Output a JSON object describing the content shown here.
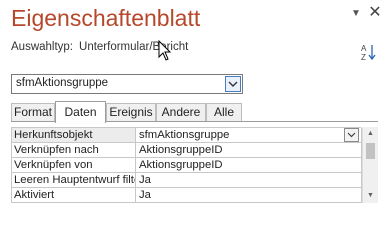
{
  "pane": {
    "title": "Eigenschaftenblatt",
    "dropdown_glyph": "▼",
    "close_glyph": "✕",
    "selection_type_label": "Auswahltyp:",
    "selection_type_value": "Unterformular/Bericht",
    "sort_icon": "sort-az-icon"
  },
  "object_combo": {
    "value": "sfmAktionsgruppe"
  },
  "tabs": [
    {
      "label": "Format"
    },
    {
      "label": "Daten"
    },
    {
      "label": "Ereignis"
    },
    {
      "label": "Andere"
    },
    {
      "label": "Alle"
    }
  ],
  "properties": [
    {
      "key": "Herkunftsobjekt",
      "value": "sfmAktionsgruppe"
    },
    {
      "key": "Verknüpfen nach",
      "value": "AktionsgruppeID"
    },
    {
      "key": "Verknüpfen von",
      "value": "AktionsgruppeID"
    },
    {
      "key": "Leeren Hauptentwurf filtern",
      "value": "Ja"
    },
    {
      "key": "Aktiviert",
      "value": "Ja"
    }
  ],
  "scrollbar": {
    "up_glyph": "▲",
    "down_glyph": "▼"
  },
  "colors": {
    "title": "#b7472a",
    "active_tab": "#ffffff",
    "inactive_tab": "#f0f0f0",
    "combo_arrow_border": "#4a7bbf"
  }
}
